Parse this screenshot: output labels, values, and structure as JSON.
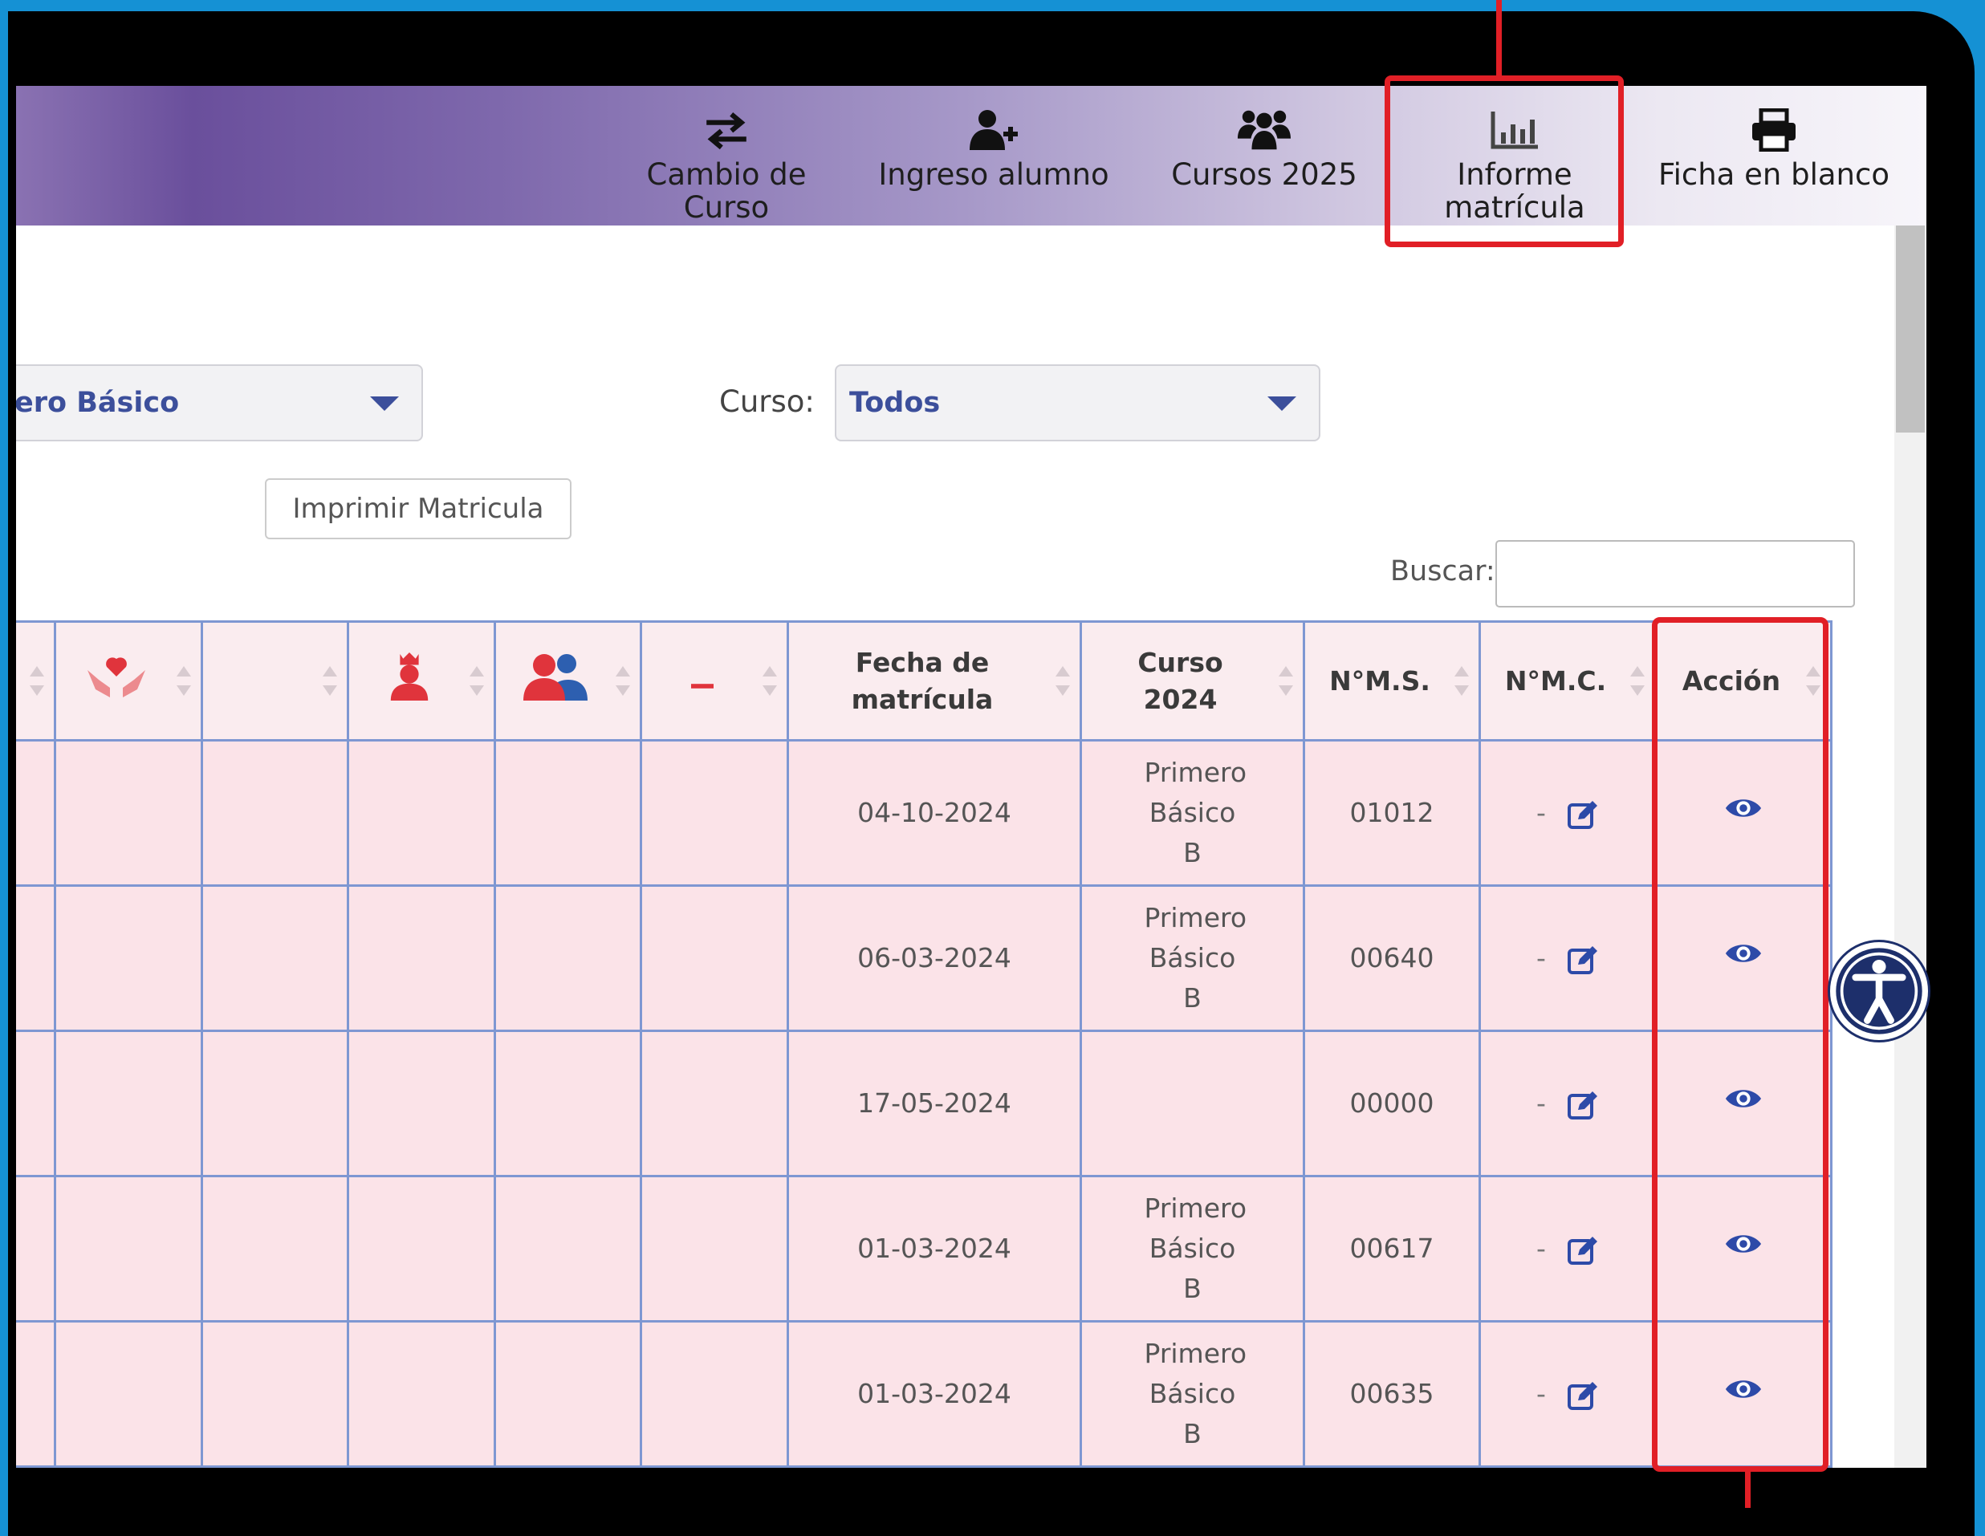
{
  "nav": [
    {
      "label": "Cambio de Curso",
      "icon": "exchange-icon"
    },
    {
      "label": "Ingreso alumno",
      "icon": "user-plus-icon"
    },
    {
      "label": "Cursos 2025",
      "icon": "users-icon"
    },
    {
      "label": "Informe matrícula",
      "icon": "bar-chart-icon"
    },
    {
      "label": "Ficha en blanco",
      "icon": "print-icon"
    }
  ],
  "filters": {
    "nivel_value": "ero Básico",
    "curso_label": "Curso:",
    "curso_value": "Todos"
  },
  "print_button": "Imprimir Matricula",
  "search": {
    "label": "Buscar:",
    "value": ""
  },
  "table": {
    "icon_columns": [
      "hands-heart-icon",
      "blank",
      "crown-person-icon",
      "users-color-icon",
      "minus-icon"
    ],
    "headers": {
      "fecha": "Fecha de matrícula",
      "curso": "Curso 2024",
      "nms": "N°M.S.",
      "nmc": "N°M.C.",
      "accion": "Acción"
    },
    "rows": [
      {
        "fecha": "04-10-2024",
        "curso": "Primero Básico B",
        "nms": "01012",
        "nmc": "-"
      },
      {
        "fecha": "06-03-2024",
        "curso": "Primero Básico B",
        "nms": "00640",
        "nmc": "-"
      },
      {
        "fecha": "17-05-2024",
        "curso": "",
        "nms": "00000",
        "nmc": "-"
      },
      {
        "fecha": "01-03-2024",
        "curso": "Primero Básico B",
        "nms": "00617",
        "nmc": "-"
      },
      {
        "fecha": "01-03-2024",
        "curso": "Primero Básico B",
        "nms": "00635",
        "nmc": "-"
      }
    ]
  },
  "colors": {
    "highlight": "#e11f26",
    "accent": "#3c4f9b",
    "row_bg": "#fbe3e8",
    "grid_line": "#7e97d2"
  }
}
